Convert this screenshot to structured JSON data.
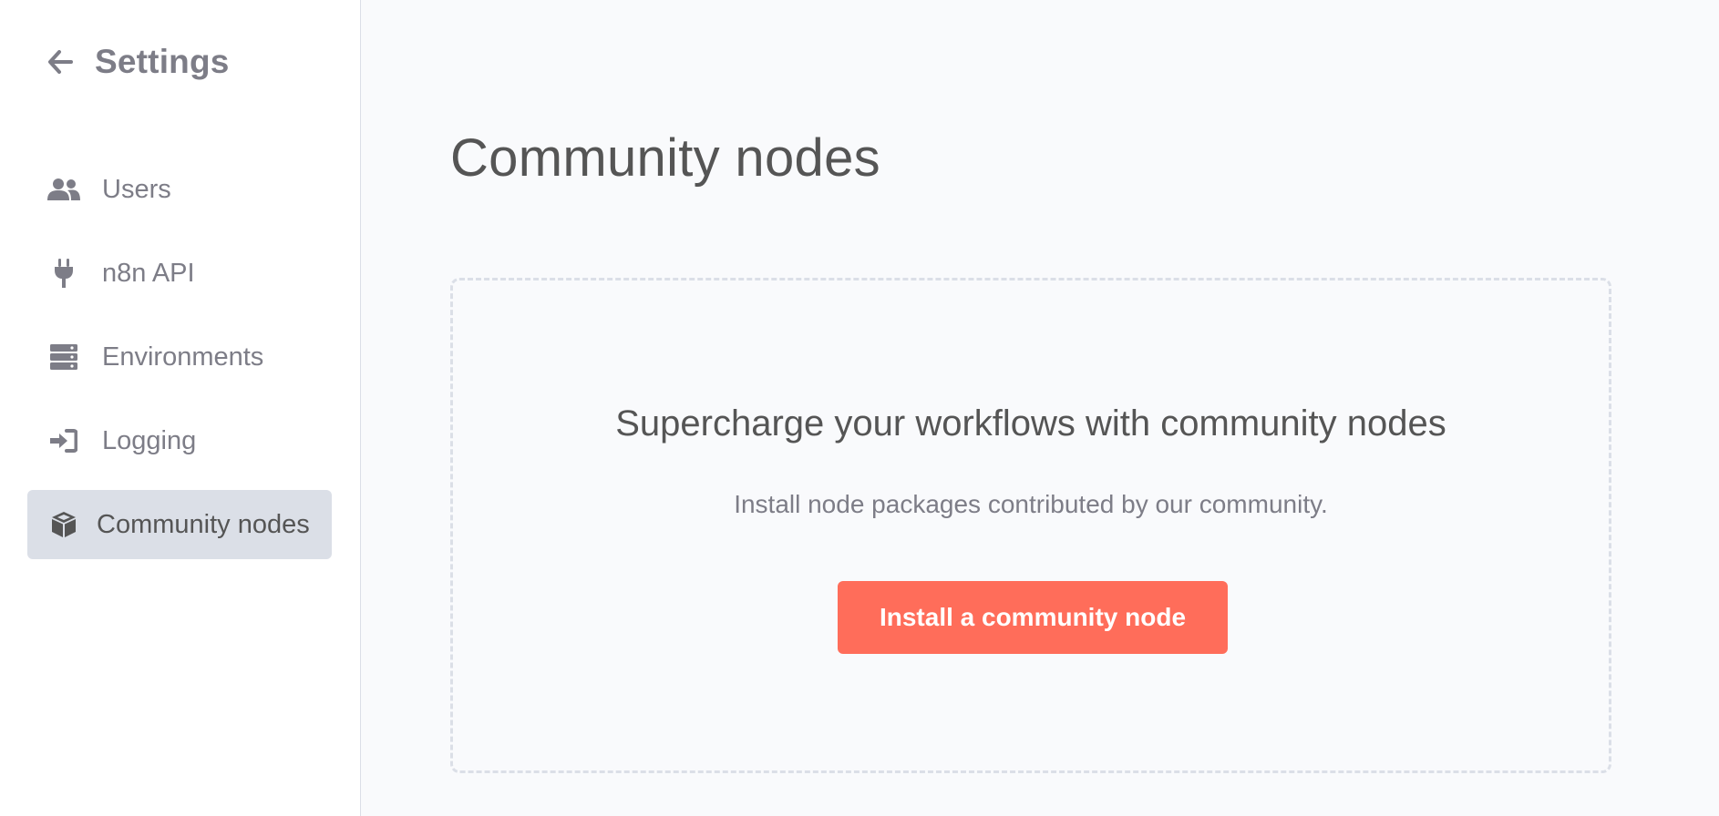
{
  "sidebar": {
    "back_icon": "arrow-left-icon",
    "title": "Settings",
    "items": [
      {
        "label": "Users",
        "icon": "users-icon",
        "active": false
      },
      {
        "label": "n8n API",
        "icon": "plug-icon",
        "active": false
      },
      {
        "label": "Environments",
        "icon": "server-icon",
        "active": false
      },
      {
        "label": "Logging",
        "icon": "sign-in-icon",
        "active": false
      },
      {
        "label": "Community nodes",
        "icon": "cube-icon",
        "active": true
      }
    ]
  },
  "main": {
    "title": "Community nodes",
    "empty_state": {
      "heading": "Supercharge your workflows with community nodes",
      "description": "Install node packages contributed by our community.",
      "button_label": "Install a community node"
    }
  },
  "colors": {
    "accent": "#ff6d5a",
    "sidebar_active_bg": "#dbdfe7",
    "text_muted": "#7d7d87",
    "text_dark": "#555555",
    "background": "#f9fafc"
  }
}
